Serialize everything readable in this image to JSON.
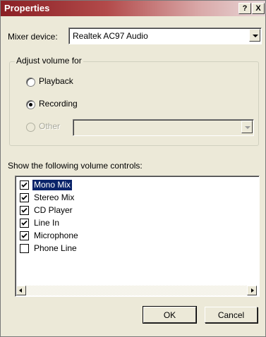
{
  "window": {
    "title": "Properties",
    "help_button": "?",
    "close_button": "X"
  },
  "mixer": {
    "label": "Mixer device:",
    "value": "Realtek AC97 Audio"
  },
  "adjust": {
    "legend": "Adjust volume for",
    "options": [
      {
        "label": "Playback",
        "selected": false,
        "enabled": true
      },
      {
        "label": "Recording",
        "selected": true,
        "enabled": true
      },
      {
        "label": "Other",
        "selected": false,
        "enabled": false
      }
    ]
  },
  "controls": {
    "label": "Show the following volume controls:",
    "items": [
      {
        "label": "Mono Mix",
        "checked": true,
        "selected": true
      },
      {
        "label": "Stereo Mix",
        "checked": true,
        "selected": false
      },
      {
        "label": "CD Player",
        "checked": true,
        "selected": false
      },
      {
        "label": "Line In",
        "checked": true,
        "selected": false
      },
      {
        "label": "Microphone",
        "checked": true,
        "selected": false
      },
      {
        "label": "Phone Line",
        "checked": false,
        "selected": false
      }
    ]
  },
  "buttons": {
    "ok": "OK",
    "cancel": "Cancel"
  },
  "colors": {
    "title_start": "#8a1f24",
    "dialog_bg": "#ece9d8",
    "selection": "#0a246a"
  }
}
